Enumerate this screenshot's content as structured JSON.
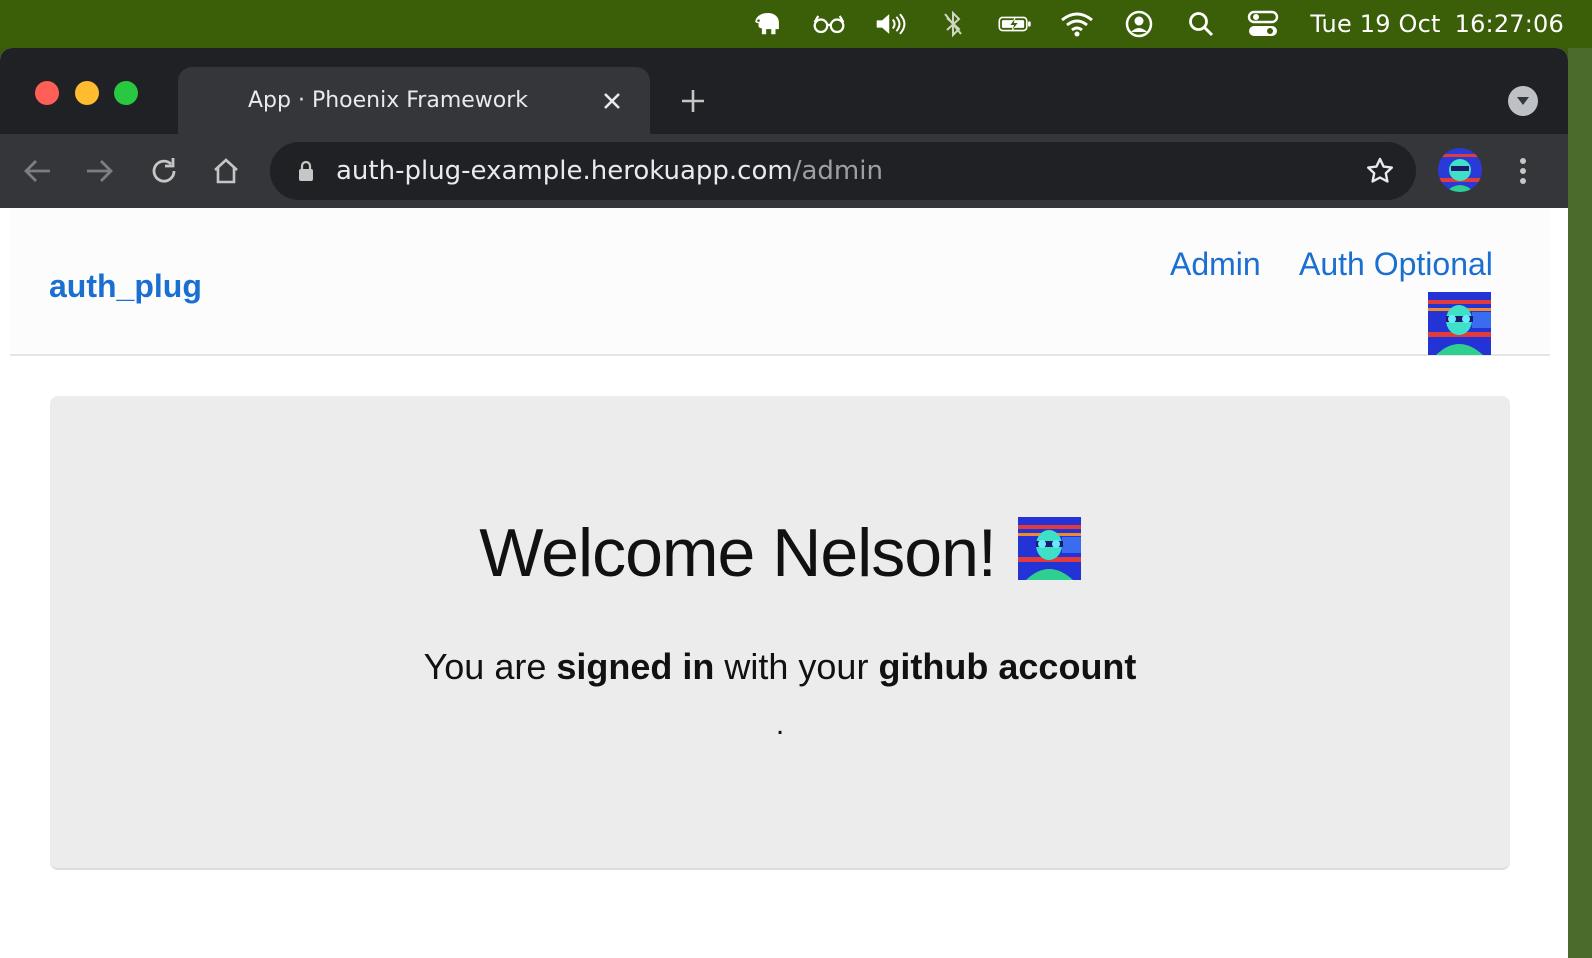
{
  "menubar": {
    "icons": [
      "elephant-icon",
      "glasses-icon",
      "volume-icon",
      "bluetooth-icon",
      "battery-charging-icon",
      "wifi-icon",
      "user-account-icon",
      "spotlight-search-icon",
      "control-center-icon"
    ],
    "date": "Tue 19 Oct",
    "time": "16:27:06"
  },
  "browser": {
    "tab_title": "App · Phoenix Framework",
    "url_host": "auth-plug-example.herokuapp.com",
    "url_path": "/admin"
  },
  "nav": {
    "brand": "auth_plug",
    "links": [
      "Admin",
      "Auth Optional"
    ]
  },
  "main": {
    "welcome": "Welcome Nelson!",
    "line_prefix": "You are ",
    "line_bold1": "signed in",
    "line_mid": " with your ",
    "line_bold2": "github account",
    "trailing": "."
  },
  "colors": {
    "link": "#1a6fd1",
    "menubar": "#3b5e08",
    "chrome_dark": "#202124",
    "chrome_mid": "#35363a",
    "jumbotron": "#ececec"
  }
}
